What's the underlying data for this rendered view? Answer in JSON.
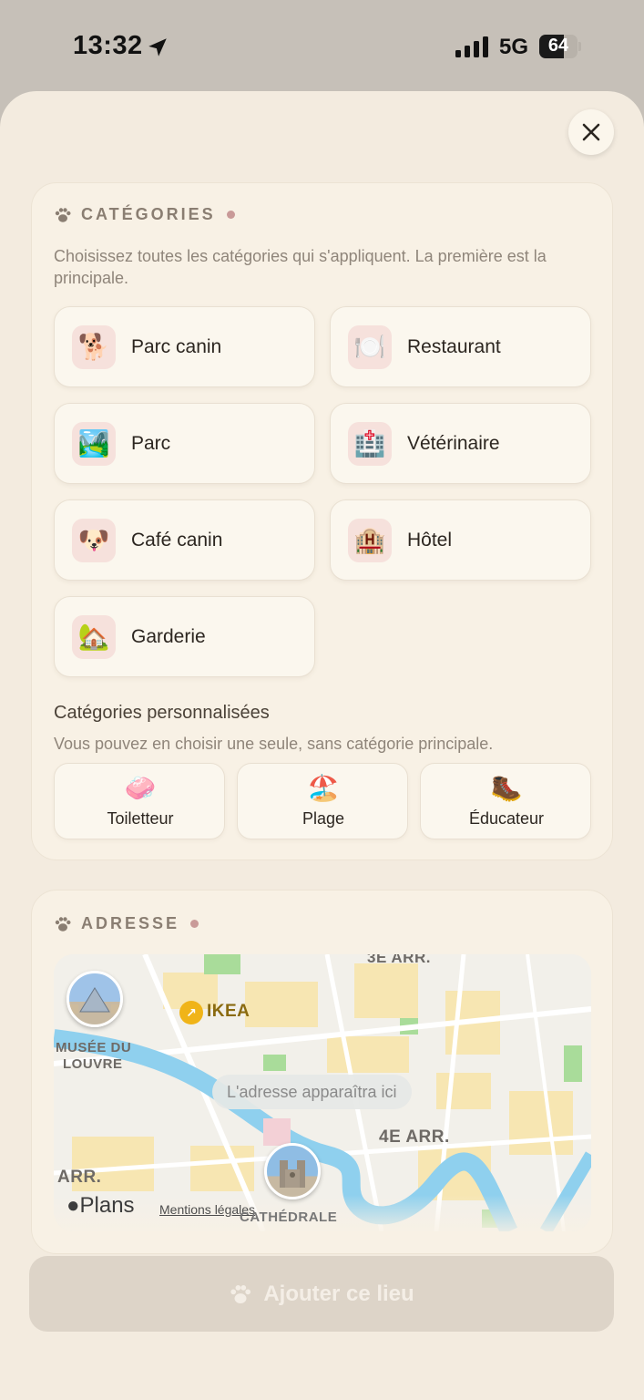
{
  "status_bar": {
    "time": "13:32",
    "network": "5G",
    "battery": "64",
    "battery_level": 0.64
  },
  "categories_section": {
    "title": "CATÉGORIES",
    "help": "Choisissez toutes les catégories qui s'appliquent. La première est la principale.",
    "items": [
      {
        "emoji": "🐕",
        "label": "Parc canin"
      },
      {
        "emoji": "🍽️",
        "label": "Restaurant"
      },
      {
        "emoji": "🏞️",
        "label": "Parc"
      },
      {
        "emoji": "🏥",
        "label": "Vétérinaire"
      },
      {
        "emoji": "🐶",
        "label": "Café canin"
      },
      {
        "emoji": "🏨",
        "label": "Hôtel"
      },
      {
        "emoji": "🏡",
        "label": "Garderie"
      }
    ],
    "custom_title": "Catégories personnalisées",
    "custom_help": "Vous pouvez en choisir une seule, sans catégorie principale.",
    "custom_items": [
      {
        "emoji": "🧼",
        "label": "Toiletteur"
      },
      {
        "emoji": "🏖️",
        "label": "Plage"
      },
      {
        "emoji": "🥾",
        "label": "Éducateur"
      }
    ]
  },
  "address_section": {
    "title": "ADRESSE",
    "map": {
      "address_placeholder": "L'adresse apparaîtra ici",
      "labels": {
        "arr3": "3E ARR.",
        "ikea": "IKEA",
        "louvre_1": "MUSÉE DU",
        "louvre_2": "LOUVRE",
        "arr4": "4E ARR.",
        "arr_left": "ARR.",
        "cathedrale": "CATHÉDRALE"
      },
      "plans": "Plans",
      "legal": "Mentions légales"
    }
  },
  "add_button": {
    "label": "Ajouter ce lieu"
  },
  "colors": {
    "sheet": "#f3ebdf",
    "card": "#f8f1e5",
    "accent_dot": "#c99a98",
    "button_disabled": "#ddd4c8"
  }
}
